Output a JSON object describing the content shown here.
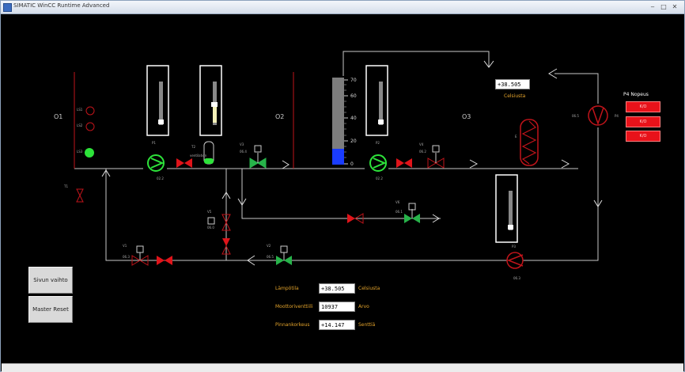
{
  "window": {
    "title": "SIMATIC WinCC Runtime Advanced",
    "minimize": "‒",
    "maximize": "□",
    "close": "✕"
  },
  "sections": {
    "o1": "O1",
    "o2": "O2",
    "o3": "O3"
  },
  "tag_labels": {
    "ls1": "LS1",
    "ls2": "LS2",
    "ls3": "LS3",
    "p1": "P1",
    "p2": "P2",
    "p3": "P3",
    "p4": "P4",
    "t1": "T1",
    "t2": "T2",
    "t3": "T3",
    "v1": "V1",
    "v2": "V2",
    "v3": "V3",
    "v4": "V4",
    "v5": "V5",
    "v6": "V6",
    "ventilation": "ventilation",
    "heater": "E",
    "speed_label": "P4",
    "s1": "S1",
    "s2": "S2",
    "s3": "S3"
  },
  "small_values": {
    "p1": "02.2",
    "p2": "02.2",
    "v3": "06.4",
    "v4": "06.2",
    "v1": "06.3",
    "v2": "06.5",
    "v5": "06.0",
    "v6": "06.1",
    "p3": "06.3",
    "p4": "06.5"
  },
  "level_scale": {
    "ticks": [
      "70",
      "60",
      "40",
      "20",
      "0"
    ],
    "fill_fraction": 0.18
  },
  "temperature": {
    "value": "+38.505",
    "unit": "Celsiusta"
  },
  "speed": {
    "title": "P4 Nopeus",
    "buttons": [
      "K/O",
      "K/O",
      "K/O"
    ]
  },
  "buttons": {
    "page_switch": "Sivun vaihto",
    "master_reset": "Master Reset"
  },
  "panel": {
    "rows": [
      {
        "label": "Lämpötila",
        "value": "+38.505",
        "unit": "Celsiusta"
      },
      {
        "label": "Moottoriventtiili",
        "value": "10937",
        "unit": "Arvo"
      },
      {
        "label": "Pinnankorkeus",
        "value": "+14.147",
        "unit": "Senttiä"
      }
    ]
  },
  "colors": {
    "pipe": "#c8c8c8",
    "tank_wall": "#c0141a",
    "level_fill": "#1a3cff",
    "pump": "#2de33a",
    "valve_open": "#27b34a",
    "valve_closed": "#e0141a",
    "accent_text": "#e3a32b"
  }
}
